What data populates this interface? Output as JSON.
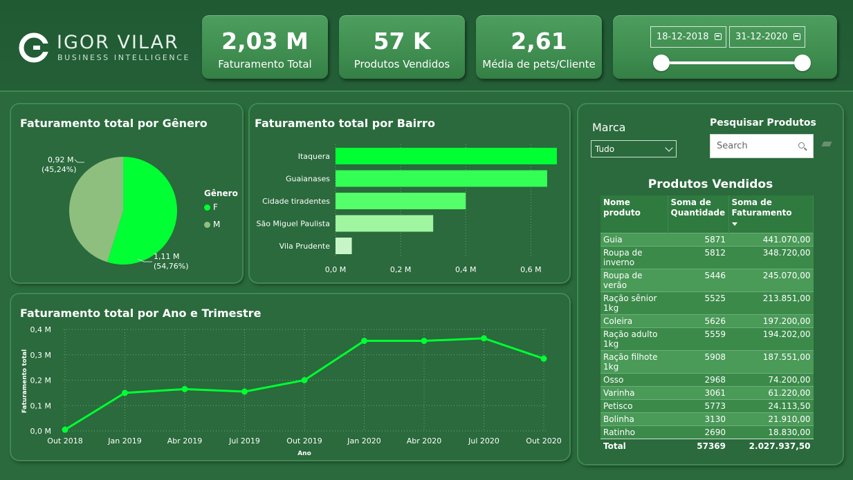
{
  "logo": {
    "title": "IGOR VILAR",
    "subtitle": "BUSINESS INTELLIGENCE"
  },
  "kpis": [
    {
      "value": "2,03 M",
      "label": "Faturamento Total"
    },
    {
      "value": "57 K",
      "label": "Produtos Vendidos"
    },
    {
      "value": "2,61",
      "label": "Média de pets/Cliente"
    }
  ],
  "date_filter": {
    "start": "18-12-2018",
    "end": "31-12-2020",
    "range_fraction": [
      0,
      1
    ]
  },
  "gender_chart": {
    "title": "Faturamento total por Gênero",
    "legend_title": "Gênero",
    "labels": {
      "m_value": "0,92 M",
      "m_pct": "(45,24%)",
      "f_value": "1,11 M",
      "f_pct": "(54,76%)"
    }
  },
  "bairro_chart": {
    "title": "Faturamento total por Bairro"
  },
  "trimestre_chart": {
    "title": "Faturamento total por Ano e Trimestre"
  },
  "filters": {
    "marca_label": "Marca",
    "marca_value": "Tudo",
    "search_label": "Pesquisar Produtos",
    "search_placeholder": "Search"
  },
  "products_table": {
    "title": "Produtos Vendidos",
    "headers": [
      "Nome produto",
      "Soma de Quantidade",
      "Soma de Faturamento"
    ],
    "rows": [
      [
        "Guia",
        "5871",
        "441.070,00"
      ],
      [
        "Roupa de inverno",
        "5812",
        "348.720,00"
      ],
      [
        "Roupa de verão",
        "5446",
        "245.070,00"
      ],
      [
        "Ração sênior 1kg",
        "5525",
        "213.851,00"
      ],
      [
        "Coleira",
        "5626",
        "197.200,00"
      ],
      [
        "Ração adulto 1kg",
        "5559",
        "194.202,00"
      ],
      [
        "Ração filhote 1kg",
        "5908",
        "187.551,00"
      ],
      [
        "Osso",
        "2968",
        "74.200,00"
      ],
      [
        "Varinha",
        "3061",
        "61.220,00"
      ],
      [
        "Petisco",
        "5773",
        "24.113,50"
      ],
      [
        "Bolinha",
        "3130",
        "21.910,00"
      ],
      [
        "Ratinho",
        "2690",
        "18.830,00"
      ]
    ],
    "total": [
      "Total",
      "57369",
      "2.027.937,50"
    ]
  },
  "colors": {
    "accent": "#00ff33",
    "background": "#2a6a3c",
    "m_color": "#8fbf7f",
    "bar_colors": [
      "#00ff33",
      "#33ff55",
      "#55ff6a",
      "#a0f5a0",
      "#c8f5c8"
    ]
  },
  "chart_data": [
    {
      "type": "pie",
      "title": "Faturamento total por Gênero",
      "legend_title": "Gênero",
      "legend_position": "right",
      "slices": [
        {
          "name": "F",
          "value": 1.11,
          "percent": 54.76,
          "color": "#00ff33"
        },
        {
          "name": "M",
          "value": 0.92,
          "percent": 45.24,
          "color": "#8fbf7f"
        }
      ]
    },
    {
      "type": "bar",
      "orientation": "horizontal",
      "title": "Faturamento total por Bairro",
      "categories": [
        "Itaquera",
        "Guaianases",
        "Cidade tiradentes",
        "São Miguel Paulista",
        "Vila Prudente"
      ],
      "values": [
        0.68,
        0.65,
        0.4,
        0.3,
        0.05
      ],
      "x_ticks": [
        "0,0 M",
        "0,2 M",
        "0,4 M",
        "0,6 M"
      ],
      "xlim": [
        0,
        0.68
      ],
      "grid": true
    },
    {
      "type": "line",
      "title": "Faturamento total por Ano e Trimestre",
      "xlabel": "Ano",
      "ylabel": "Faturamento total",
      "categories": [
        "Out 2018",
        "Jan 2019",
        "Abr 2019",
        "Jul 2019",
        "Out 2019",
        "Jan 2020",
        "Abr 2020",
        "Jul 2020",
        "Out 2020"
      ],
      "values": [
        0.005,
        0.15,
        0.165,
        0.155,
        0.2,
        0.355,
        0.355,
        0.365,
        0.285
      ],
      "y_ticks": [
        "0,0 M",
        "0,1 M",
        "0,2 M",
        "0,3 M",
        "0,4 M"
      ],
      "ylim": [
        0,
        0.4
      ],
      "grid": true
    }
  ]
}
